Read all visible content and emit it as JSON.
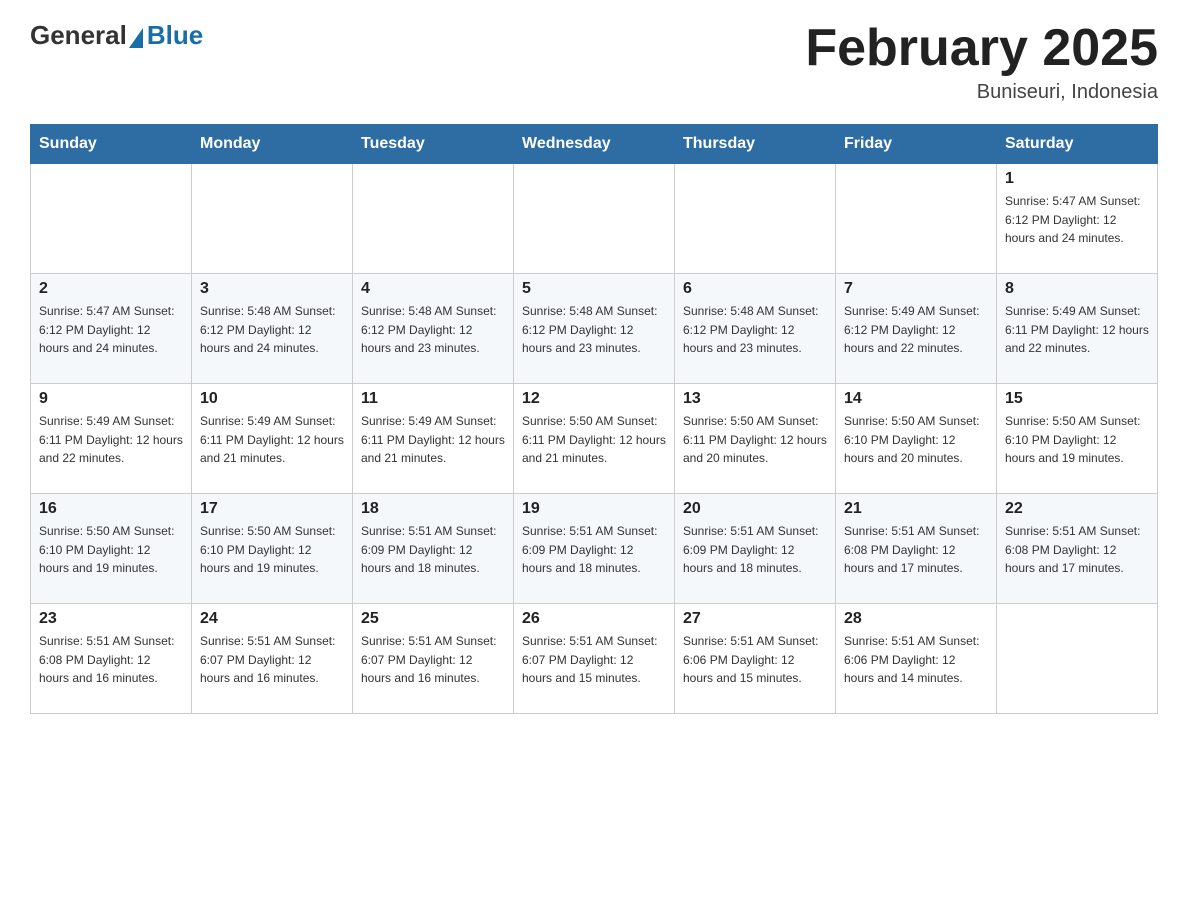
{
  "header": {
    "logo": {
      "general": "General",
      "blue": "Blue"
    },
    "title": "February 2025",
    "location": "Buniseuri, Indonesia"
  },
  "weekdays": [
    "Sunday",
    "Monday",
    "Tuesday",
    "Wednesday",
    "Thursday",
    "Friday",
    "Saturday"
  ],
  "weeks": [
    [
      {
        "day": "",
        "info": ""
      },
      {
        "day": "",
        "info": ""
      },
      {
        "day": "",
        "info": ""
      },
      {
        "day": "",
        "info": ""
      },
      {
        "day": "",
        "info": ""
      },
      {
        "day": "",
        "info": ""
      },
      {
        "day": "1",
        "info": "Sunrise: 5:47 AM\nSunset: 6:12 PM\nDaylight: 12 hours\nand 24 minutes."
      }
    ],
    [
      {
        "day": "2",
        "info": "Sunrise: 5:47 AM\nSunset: 6:12 PM\nDaylight: 12 hours\nand 24 minutes."
      },
      {
        "day": "3",
        "info": "Sunrise: 5:48 AM\nSunset: 6:12 PM\nDaylight: 12 hours\nand 24 minutes."
      },
      {
        "day": "4",
        "info": "Sunrise: 5:48 AM\nSunset: 6:12 PM\nDaylight: 12 hours\nand 23 minutes."
      },
      {
        "day": "5",
        "info": "Sunrise: 5:48 AM\nSunset: 6:12 PM\nDaylight: 12 hours\nand 23 minutes."
      },
      {
        "day": "6",
        "info": "Sunrise: 5:48 AM\nSunset: 6:12 PM\nDaylight: 12 hours\nand 23 minutes."
      },
      {
        "day": "7",
        "info": "Sunrise: 5:49 AM\nSunset: 6:12 PM\nDaylight: 12 hours\nand 22 minutes."
      },
      {
        "day": "8",
        "info": "Sunrise: 5:49 AM\nSunset: 6:11 PM\nDaylight: 12 hours\nand 22 minutes."
      }
    ],
    [
      {
        "day": "9",
        "info": "Sunrise: 5:49 AM\nSunset: 6:11 PM\nDaylight: 12 hours\nand 22 minutes."
      },
      {
        "day": "10",
        "info": "Sunrise: 5:49 AM\nSunset: 6:11 PM\nDaylight: 12 hours\nand 21 minutes."
      },
      {
        "day": "11",
        "info": "Sunrise: 5:49 AM\nSunset: 6:11 PM\nDaylight: 12 hours\nand 21 minutes."
      },
      {
        "day": "12",
        "info": "Sunrise: 5:50 AM\nSunset: 6:11 PM\nDaylight: 12 hours\nand 21 minutes."
      },
      {
        "day": "13",
        "info": "Sunrise: 5:50 AM\nSunset: 6:11 PM\nDaylight: 12 hours\nand 20 minutes."
      },
      {
        "day": "14",
        "info": "Sunrise: 5:50 AM\nSunset: 6:10 PM\nDaylight: 12 hours\nand 20 minutes."
      },
      {
        "day": "15",
        "info": "Sunrise: 5:50 AM\nSunset: 6:10 PM\nDaylight: 12 hours\nand 19 minutes."
      }
    ],
    [
      {
        "day": "16",
        "info": "Sunrise: 5:50 AM\nSunset: 6:10 PM\nDaylight: 12 hours\nand 19 minutes."
      },
      {
        "day": "17",
        "info": "Sunrise: 5:50 AM\nSunset: 6:10 PM\nDaylight: 12 hours\nand 19 minutes."
      },
      {
        "day": "18",
        "info": "Sunrise: 5:51 AM\nSunset: 6:09 PM\nDaylight: 12 hours\nand 18 minutes."
      },
      {
        "day": "19",
        "info": "Sunrise: 5:51 AM\nSunset: 6:09 PM\nDaylight: 12 hours\nand 18 minutes."
      },
      {
        "day": "20",
        "info": "Sunrise: 5:51 AM\nSunset: 6:09 PM\nDaylight: 12 hours\nand 18 minutes."
      },
      {
        "day": "21",
        "info": "Sunrise: 5:51 AM\nSunset: 6:08 PM\nDaylight: 12 hours\nand 17 minutes."
      },
      {
        "day": "22",
        "info": "Sunrise: 5:51 AM\nSunset: 6:08 PM\nDaylight: 12 hours\nand 17 minutes."
      }
    ],
    [
      {
        "day": "23",
        "info": "Sunrise: 5:51 AM\nSunset: 6:08 PM\nDaylight: 12 hours\nand 16 minutes."
      },
      {
        "day": "24",
        "info": "Sunrise: 5:51 AM\nSunset: 6:07 PM\nDaylight: 12 hours\nand 16 minutes."
      },
      {
        "day": "25",
        "info": "Sunrise: 5:51 AM\nSunset: 6:07 PM\nDaylight: 12 hours\nand 16 minutes."
      },
      {
        "day": "26",
        "info": "Sunrise: 5:51 AM\nSunset: 6:07 PM\nDaylight: 12 hours\nand 15 minutes."
      },
      {
        "day": "27",
        "info": "Sunrise: 5:51 AM\nSunset: 6:06 PM\nDaylight: 12 hours\nand 15 minutes."
      },
      {
        "day": "28",
        "info": "Sunrise: 5:51 AM\nSunset: 6:06 PM\nDaylight: 12 hours\nand 14 minutes."
      },
      {
        "day": "",
        "info": ""
      }
    ]
  ]
}
